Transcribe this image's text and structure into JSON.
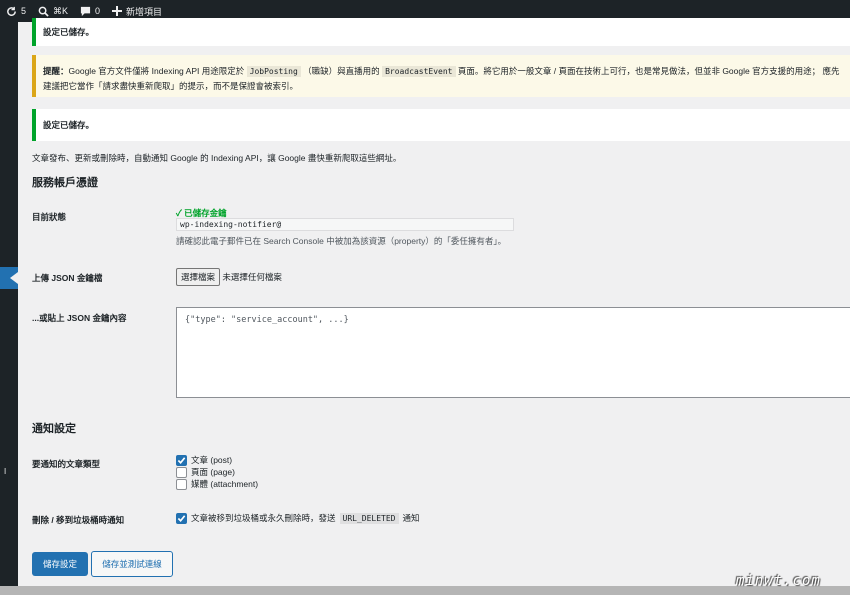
{
  "adminbar": {
    "updates_count": "5",
    "shortcut": "⌘K",
    "comments_count": "0",
    "new_label": "新增項目"
  },
  "sidebar": {
    "edge_text": "I"
  },
  "notices": {
    "saved1": "設定已儲存。",
    "warning_bold": "提醒：",
    "warning_part1": "Google 官方文件僅將 Indexing API 用途限定於",
    "warning_code1": "JobPosting",
    "warning_part2": "（職缺）與直播用的",
    "warning_code2": "BroadcastEvent",
    "warning_part3": "頁面。將它用於一般文章 / 頁面在技術上可行，也是常見做法，但並非 Google 官方支援的用途； 應先",
    "warning_line2": "建議把它當作「請求盡快重新爬取」的提示，而不是保證會被索引。",
    "saved2": "設定已儲存。"
  },
  "description": "文章發布、更新或刪除時，自動通知 Google 的 Indexing API，讓 Google 盡快重新爬取這些網址。",
  "section_credentials": {
    "heading": "服務帳戶憑證",
    "status_label": "目前狀態",
    "status_value": "✓ 已儲存金鑰",
    "email": "wp-indexing-notifier@",
    "hint": "請確認此電子郵件已在 Search Console 中被加為該資源（property）的「委任擁有者」。",
    "upload_label": "上傳 JSON 金鑰檔",
    "file_button": "選擇檔案",
    "file_status": "未選擇任何檔案",
    "paste_label": "...或貼上 JSON 金鑰內容",
    "paste_placeholder": "{\"type\": \"service_account\", ...}"
  },
  "section_notify": {
    "heading": "通知設定",
    "post_types_label": "要通知的文章類型",
    "post_types": [
      {
        "label": "文章 (post)",
        "checked": true
      },
      {
        "label": "頁面 (page)",
        "checked": false
      },
      {
        "label": "媒體 (attachment)",
        "checked": false
      }
    ],
    "delete_label": "刪除 / 移到垃圾桶時通知",
    "delete_text_before": "文章被移到垃圾桶或永久刪除時，發送",
    "delete_code": "URL_DELETED",
    "delete_text_after": "通知",
    "delete_checked": true
  },
  "buttons": {
    "save": "儲存設定",
    "save_test": "儲存並測試連線"
  },
  "watermark": "minwt.com"
}
